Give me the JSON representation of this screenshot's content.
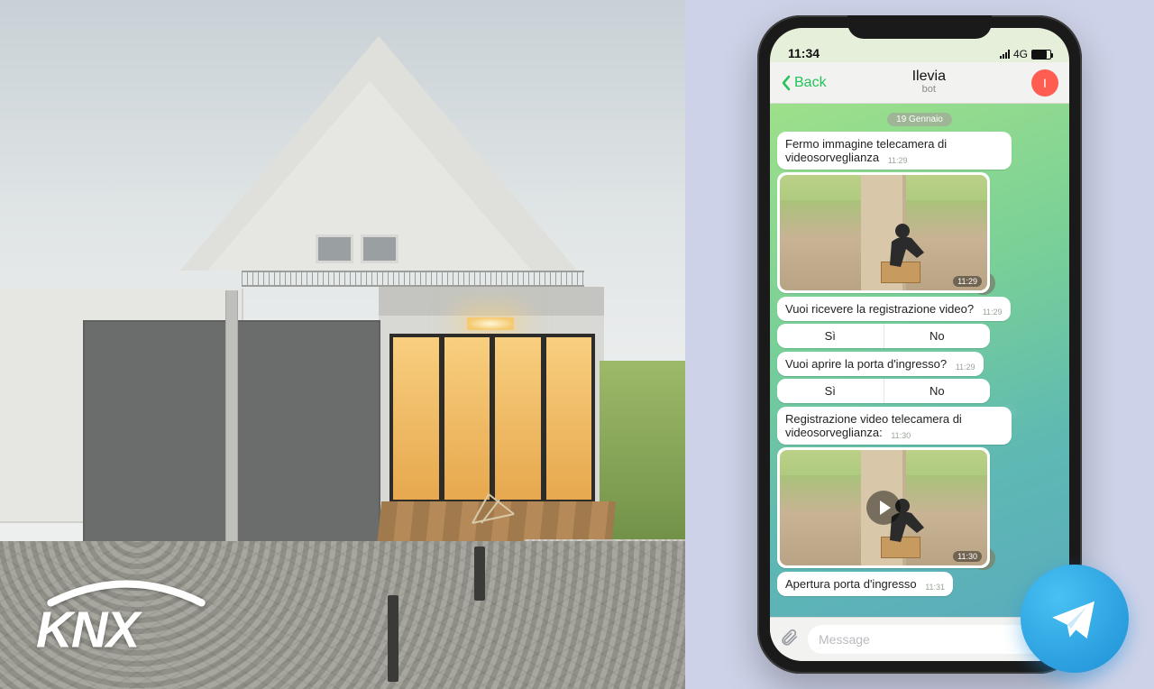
{
  "brand": {
    "logo_text": "KNX"
  },
  "phone": {
    "statusbar": {
      "time": "11:34",
      "network": "4G"
    },
    "chat": {
      "back_label": "Back",
      "title": "Ilevia",
      "subtitle": "bot",
      "avatar_initial": "I",
      "date_badge": "19 Gennaio",
      "input_placeholder": "Message",
      "messages": [
        {
          "kind": "text",
          "text": "Fermo immagine telecamera di videosorveglianza",
          "time": "11:29"
        },
        {
          "kind": "image",
          "time": "11:29"
        },
        {
          "kind": "text",
          "text": "Vuoi ricevere la registrazione video?",
          "time": "11:29"
        },
        {
          "kind": "buttons",
          "options": [
            "Sì",
            "No"
          ]
        },
        {
          "kind": "text",
          "text": "Vuoi aprire la porta d'ingresso?",
          "time": "11:29"
        },
        {
          "kind": "buttons",
          "options": [
            "Sì",
            "No"
          ]
        },
        {
          "kind": "text",
          "text": "Registrazione video telecamera di videosorveglianza:",
          "time": "11:30"
        },
        {
          "kind": "video",
          "time": "11:30"
        },
        {
          "kind": "text",
          "text": "Apertura porta d'ingresso",
          "time": "11:31"
        }
      ]
    }
  },
  "badge": {
    "name": "telegram-logo"
  }
}
